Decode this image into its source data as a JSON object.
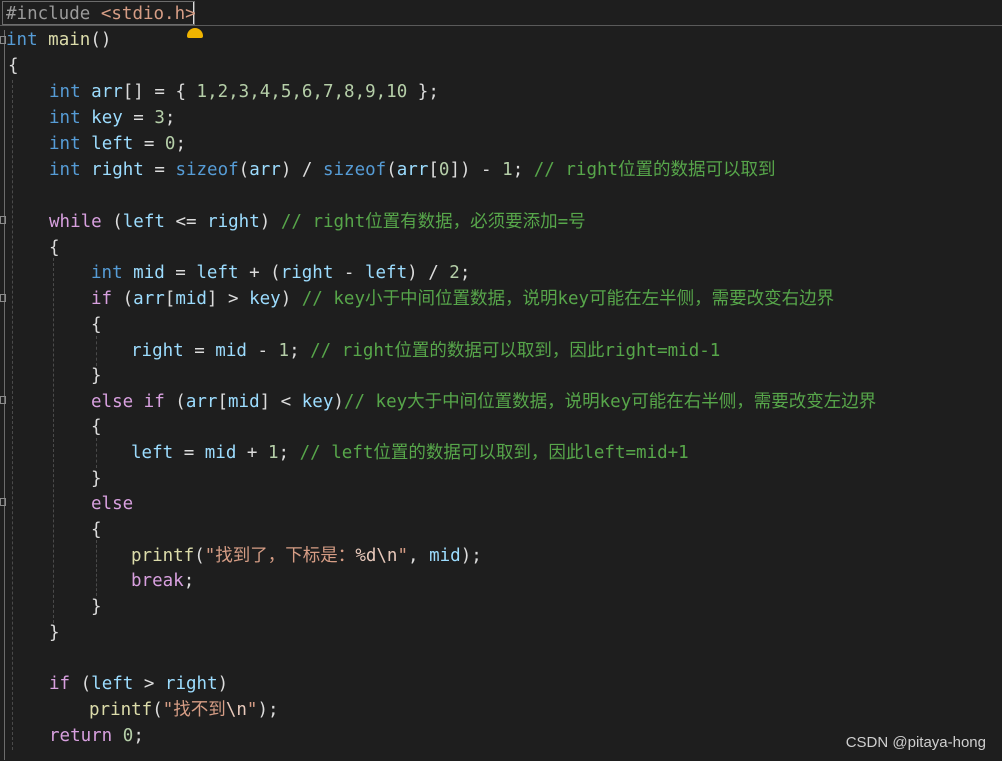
{
  "editor": {
    "watermark": "CSDN @pitaya-hong",
    "code": {
      "l1_pp": "#include",
      "l1_inc": "<stdio.h>",
      "l2_kw": "int",
      "l2_fn": "main",
      "l2_rest": "()",
      "l3": "{",
      "l4_kw": "int",
      "l4_var": "arr",
      "l4_rest1": "[] = { ",
      "l4_nums": "1,2,3,4,5,6,7,8,9,10",
      "l4_rest2": " };",
      "l5_kw": "int",
      "l5_var": "key",
      "l5_rest": " = ",
      "l5_num": "3",
      "l5_end": ";",
      "l6_kw": "int",
      "l6_var": "left",
      "l6_rest": " = ",
      "l6_num": "0",
      "l6_end": ";",
      "l7_kw": "int",
      "l7_var": "right",
      "l7_eq": " = ",
      "l7_kw2": "sizeof",
      "l7_p1": "(",
      "l7_var2": "arr",
      "l7_p2": ") / ",
      "l7_kw3": "sizeof",
      "l7_p3": "(",
      "l7_var3": "arr",
      "l7_p4": "[",
      "l7_num1": "0",
      "l7_p5": "]) - ",
      "l7_num2": "1",
      "l7_p6": "; ",
      "l7_cmt": "// right位置的数据可以取到",
      "l9_ctl": "while",
      "l9_p1": " (",
      "l9_var1": "left",
      "l9_op": " <= ",
      "l9_var2": "right",
      "l9_p2": ") ",
      "l9_cmt": "// right位置有数据，必须要添加=号",
      "l10": "{",
      "l11_kw": "int",
      "l11_var1": "mid",
      "l11_eq": " = ",
      "l11_var2": "left",
      "l11_op": " + (",
      "l11_var3": "right",
      "l11_op2": " - ",
      "l11_var4": "left",
      "l11_op3": ") / ",
      "l11_num": "2",
      "l11_end": ";",
      "l12_ctl": "if",
      "l12_p1": " (",
      "l12_var1": "arr",
      "l12_p2": "[",
      "l12_var2": "mid",
      "l12_p3": "] > ",
      "l12_var3": "key",
      "l12_p4": ") ",
      "l12_cmt": "// key小于中间位置数据，说明key可能在左半侧，需要改变右边界",
      "l13": "{",
      "l14_var1": "right",
      "l14_eq": " = ",
      "l14_var2": "mid",
      "l14_op": " - ",
      "l14_num": "1",
      "l14_end": "; ",
      "l14_cmt": "// right位置的数据可以取到，因此right=mid-1",
      "l15": "}",
      "l16_ctl": "else if",
      "l16_p1": " (",
      "l16_var1": "arr",
      "l16_p2": "[",
      "l16_var2": "mid",
      "l16_p3": "] < ",
      "l16_var3": "key",
      "l16_p4": ")",
      "l16_cmt": "// key大于中间位置数据，说明key可能在右半侧，需要改变左边界",
      "l17": "{",
      "l18_var1": "left",
      "l18_eq": " = ",
      "l18_var2": "mid",
      "l18_op": " + ",
      "l18_num": "1",
      "l18_end": "; ",
      "l18_cmt": "// left位置的数据可以取到，因此left=mid+1",
      "l19": "}",
      "l20_ctl": "else",
      "l21": "{",
      "l22_fn": "printf",
      "l22_p1": "(",
      "l22_str": "\"找到了，下标是：",
      "l22_fmt": "%d\\n",
      "l22_str2": "\"",
      "l22_p2": ", ",
      "l22_var": "mid",
      "l22_end": ");",
      "l23_ctl": "break",
      "l23_end": ";",
      "l24": "}",
      "l25": "}",
      "l27_ctl": "if",
      "l27_p1": " (",
      "l27_var1": "left",
      "l27_op": " > ",
      "l27_var2": "right",
      "l27_p2": ")",
      "l28_fn": "printf",
      "l28_p1": "(",
      "l28_str": "\"找不到",
      "l28_fmt": "\\n",
      "l28_str2": "\"",
      "l28_end": ");",
      "l29_ctl": "return",
      "l29_sp": " ",
      "l29_num": "0",
      "l29_end": ";"
    }
  }
}
